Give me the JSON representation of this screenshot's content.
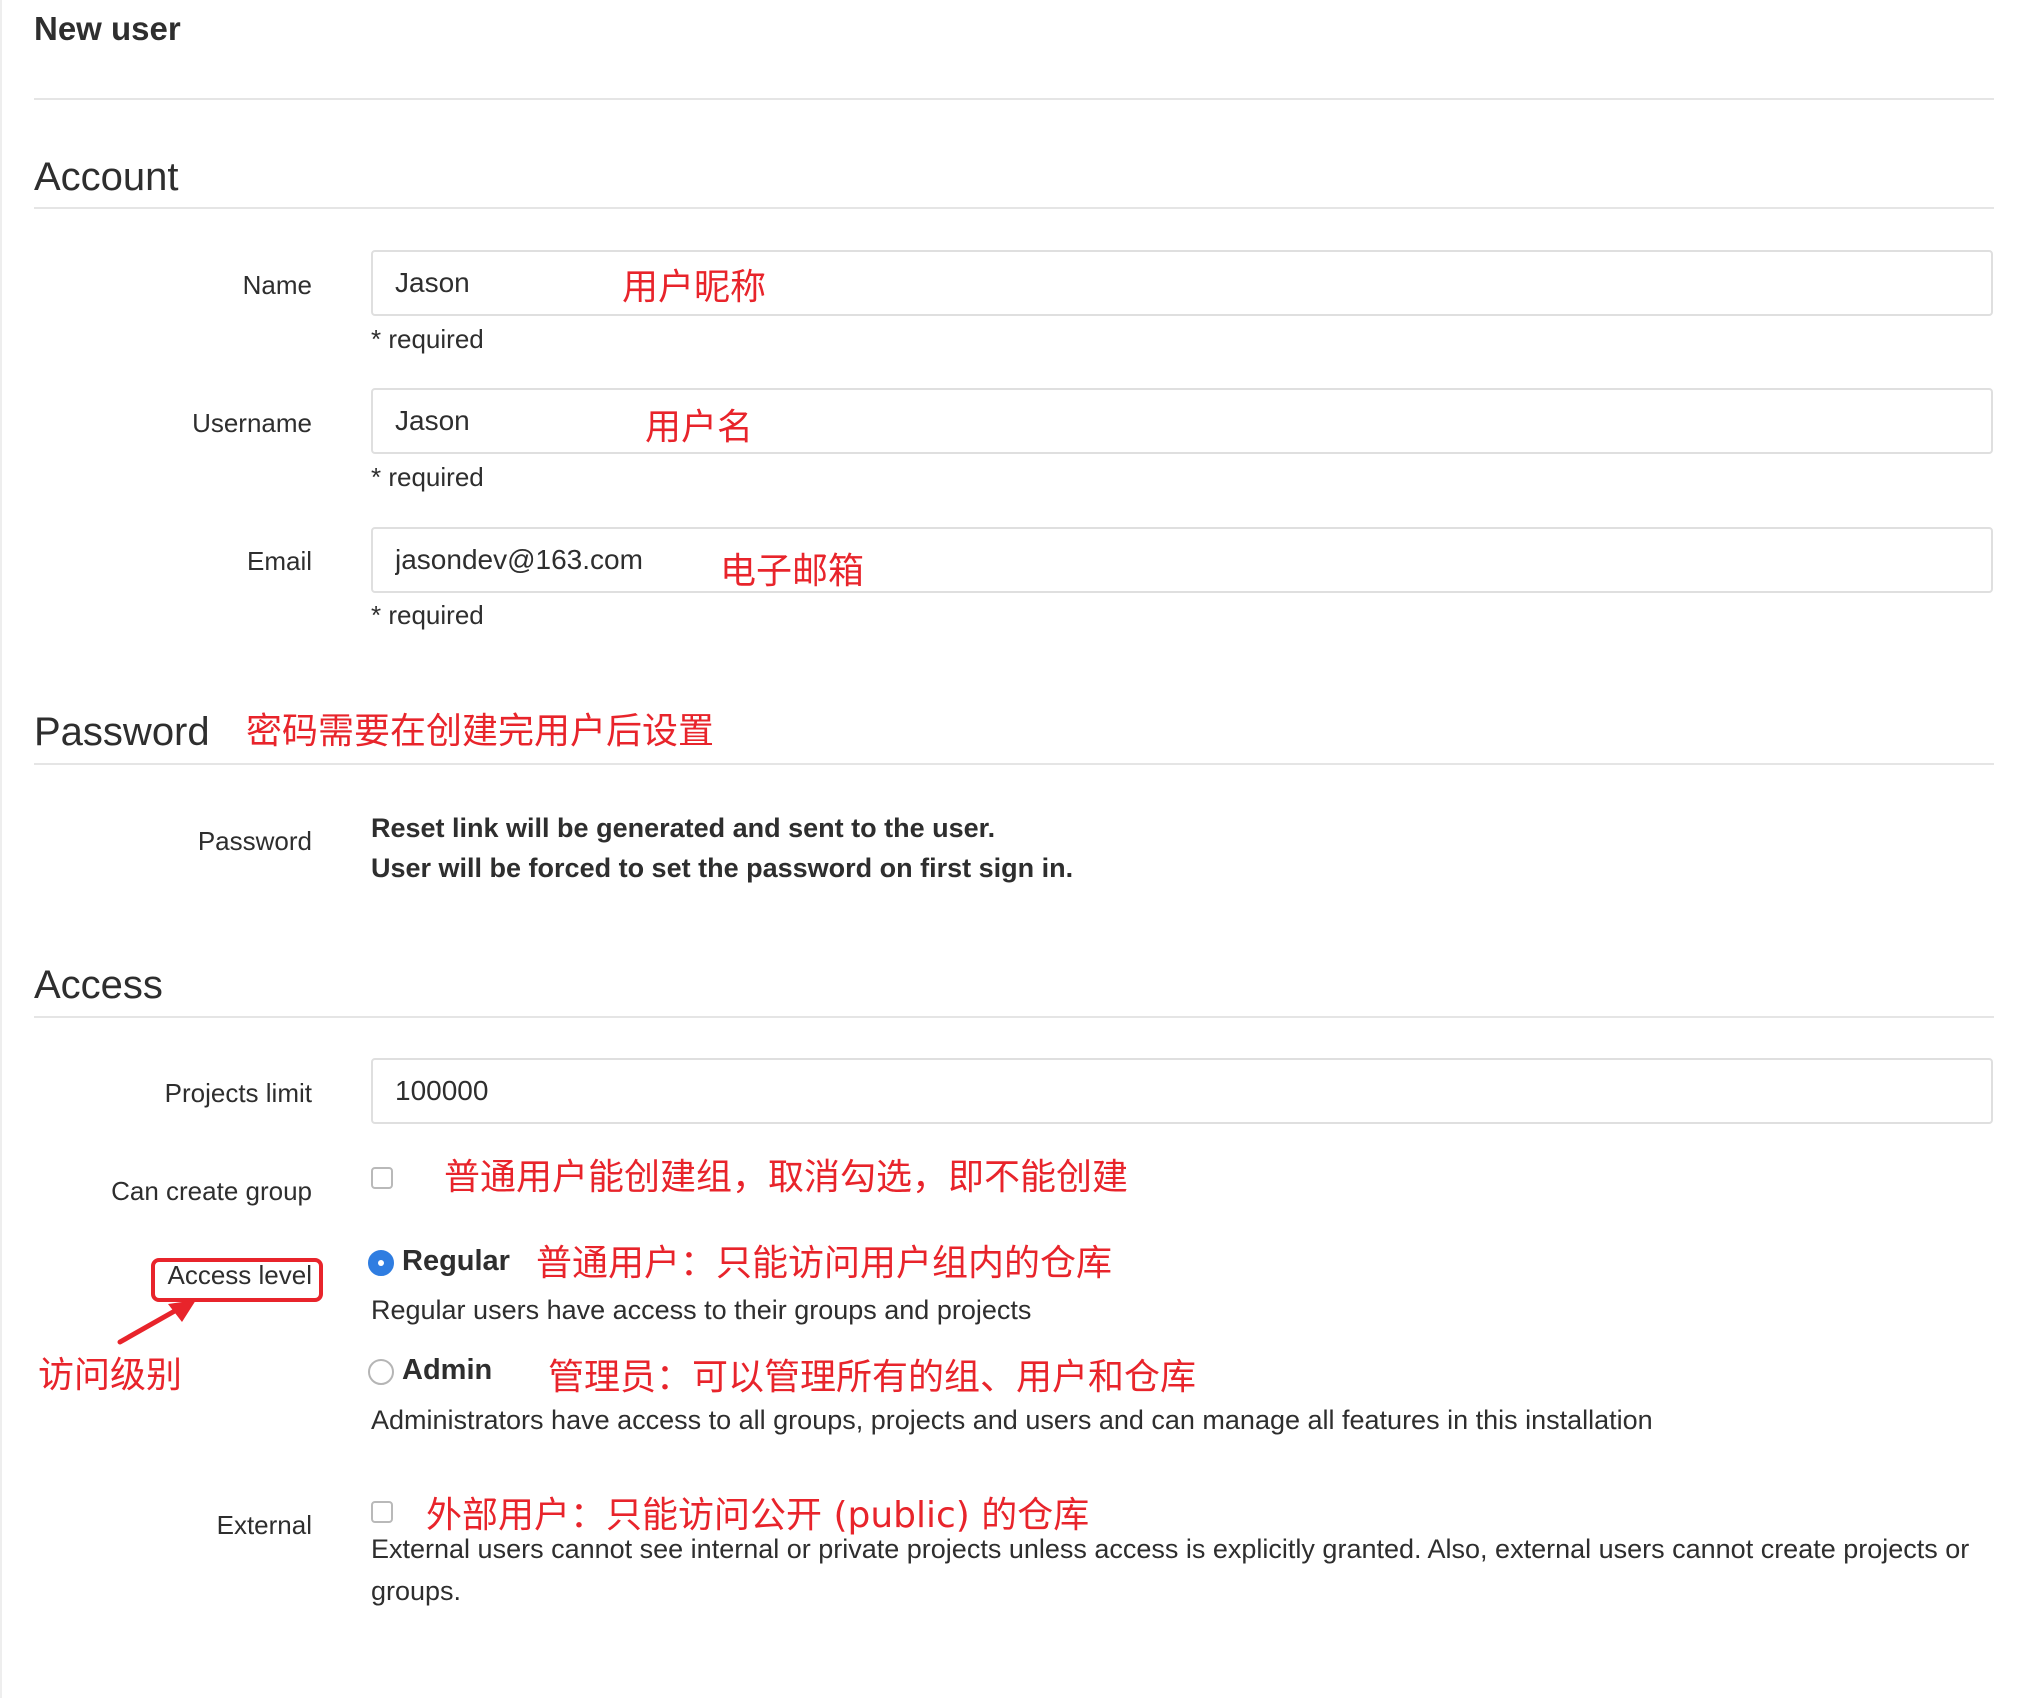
{
  "page": {
    "title": "New user"
  },
  "account": {
    "section_title": "Account",
    "name": {
      "label": "Name",
      "value": "Jason",
      "help": "* required",
      "annotation": "用户昵称"
    },
    "username": {
      "label": "Username",
      "value": "Jason",
      "help": "* required",
      "annotation": "用户名"
    },
    "email": {
      "label": "Email",
      "value": "jasondev@163.com",
      "help": "* required",
      "annotation": "电子邮箱"
    }
  },
  "password": {
    "section_title": "Password",
    "section_annotation": "密码需要在创建完用户后设置",
    "label": "Password",
    "line1": "Reset link will be generated and sent to the user.",
    "line2": "User will be forced to set the password on first sign in."
  },
  "access": {
    "section_title": "Access",
    "projects_limit": {
      "label": "Projects limit",
      "value": "100000"
    },
    "can_create_group": {
      "label": "Can create group",
      "checked": false,
      "annotation": "普通用户能创建组，取消勾选，即不能创建"
    },
    "access_level": {
      "label": "Access level",
      "annotation": "访问级别",
      "regular": {
        "label": "Regular",
        "checked": true,
        "description": "Regular users have access to their groups and projects",
        "annotation": "普通用户：只能访问用户组内的仓库"
      },
      "admin": {
        "label": "Admin",
        "checked": false,
        "description": "Administrators have access to all groups, projects and users and can manage all features in this installation",
        "annotation": "管理员：可以管理所有的组、用户和仓库"
      }
    },
    "external": {
      "label": "External",
      "checked": false,
      "annotation": "外部用户：只能访问公开 (public) 的仓库",
      "description": "External users cannot see internal or private projects unless access is explicitly granted. Also, external users cannot create projects or groups."
    }
  },
  "colors": {
    "annotation": "#e8242b",
    "accent": "#2f7de1",
    "border": "#dfdfdf",
    "text": "#2e2e2e"
  }
}
